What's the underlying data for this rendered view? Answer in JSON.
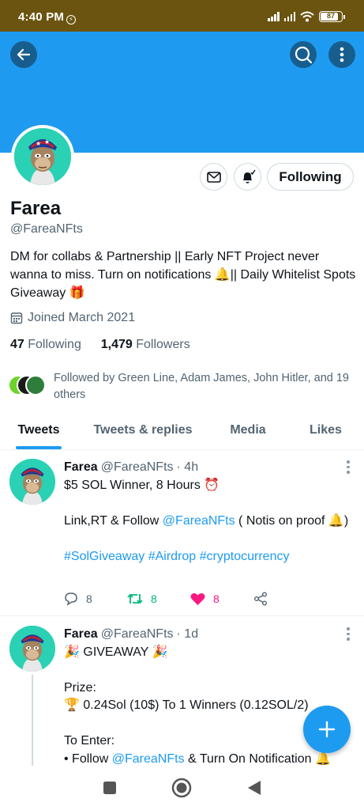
{
  "status_bar": {
    "time": "4:40 PM",
    "battery": "87",
    "icons": [
      "signal-icon",
      "signal-icon",
      "wifi-icon",
      "battery-icon"
    ]
  },
  "header": {
    "back_icon": "back-arrow-icon",
    "search_icon": "search-icon",
    "more_icon": "more-vertical-icon",
    "banner_color": "#1e9bf0"
  },
  "profile": {
    "name": "Farea",
    "handle": "@FareaNFts",
    "bio_line1": "DM for collabs & Partnership || Early NFT Project never wanna to miss. Turn on notifications ",
    "bio_bell": "🔔",
    "bio_line2": "|| Daily Whitelist Spots Giveaway ",
    "bio_gift": "🎁",
    "joined": "Joined March 2021",
    "following_count": "47",
    "following_label": "Following",
    "followers_count": "1,479",
    "followers_label": "Followers",
    "followed_by": "Followed by Green Line, Adam James, John Hitler, and 19 others",
    "buttons": {
      "message_icon": "mail-icon",
      "notify_icon": "bell-icon",
      "following": "Following"
    }
  },
  "tabs": [
    {
      "label": "Tweets",
      "active": true
    },
    {
      "label": "Tweets & replies",
      "active": false
    },
    {
      "label": "Media",
      "active": false
    },
    {
      "label": "Likes",
      "active": false
    }
  ],
  "tweets": [
    {
      "name": "Farea",
      "handle": "@FareaNFts",
      "time": "· 4h",
      "line1": "$5 SOL Winner, 8 Hours ",
      "line1_emoji": "⏰",
      "line2_pre": "Link,RT & Follow ",
      "line2_link": "@FareaNFts",
      "line2_post": " ( Notis on proof ",
      "line2_emoji": "🔔",
      "line2_end": ")",
      "hashtags": "#SolGiveaway #Airdrop #cryptocurrency",
      "replies": "8",
      "retweets": "8",
      "likes": "8",
      "accent_retweet": "#00ba7c",
      "accent_like": "#f91880"
    },
    {
      "name": "Farea",
      "handle": "@FareaNFts",
      "time": "· 1d",
      "line1_emoji": "🎉",
      "line1": " GIVEAWAY ",
      "line1_emoji2": "🎉",
      "prize_label": "Prize:",
      "prize_emoji": "🏆",
      "prize_text": " 0.24Sol (10$) To 1 Winners (0.12SOL/2)",
      "enter_label": "To Enter:",
      "enter_pre": "• Follow ",
      "enter_link": "@FareaNFts",
      "enter_post": " & Turn On Notification ",
      "enter_emoji": "🔔"
    }
  ],
  "fab": {
    "icon": "plus-icon"
  },
  "nav_bar": {
    "icons": [
      "recents-square-icon",
      "home-circle-icon",
      "back-triangle-icon"
    ]
  }
}
